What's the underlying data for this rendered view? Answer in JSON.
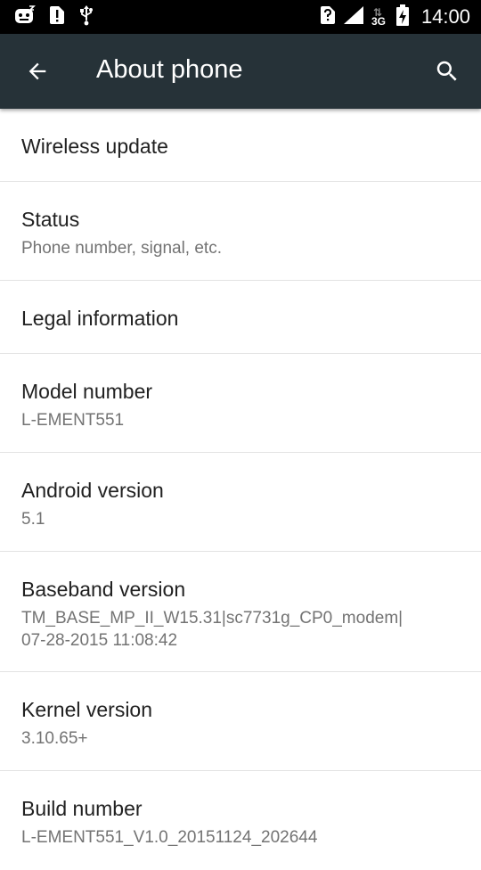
{
  "status_bar": {
    "time": "14:00",
    "network_type": "3G",
    "icons": [
      "face-notification-icon",
      "sim-alert-icon",
      "usb-icon",
      "unknown-sim-icon",
      "signal-icon",
      "data-arrows-icon",
      "battery-charging-icon"
    ]
  },
  "app_bar": {
    "title": "About phone",
    "background": "#263238"
  },
  "items": [
    {
      "title": "Wireless update",
      "summary": ""
    },
    {
      "title": "Status",
      "summary": "Phone number, signal, etc."
    },
    {
      "title": "Legal information",
      "summary": ""
    },
    {
      "title": "Model number",
      "summary": "L-EMENT551"
    },
    {
      "title": "Android version",
      "summary": "5.1"
    },
    {
      "title": "Baseband version",
      "summary": "TM_BASE_MP_II_W15.31|sc7731g_CP0_modem|\n07-28-2015 11:08:42"
    },
    {
      "title": "Kernel version",
      "summary": "3.10.65+"
    },
    {
      "title": "Build number",
      "summary": "L-EMENT551_V1.0_20151124_202644"
    }
  ],
  "baseband_lines": [
    "TM_BASE_MP_II_W15.31|sc7731g_CP0_modem|",
    "07-28-2015 11:08:42"
  ]
}
